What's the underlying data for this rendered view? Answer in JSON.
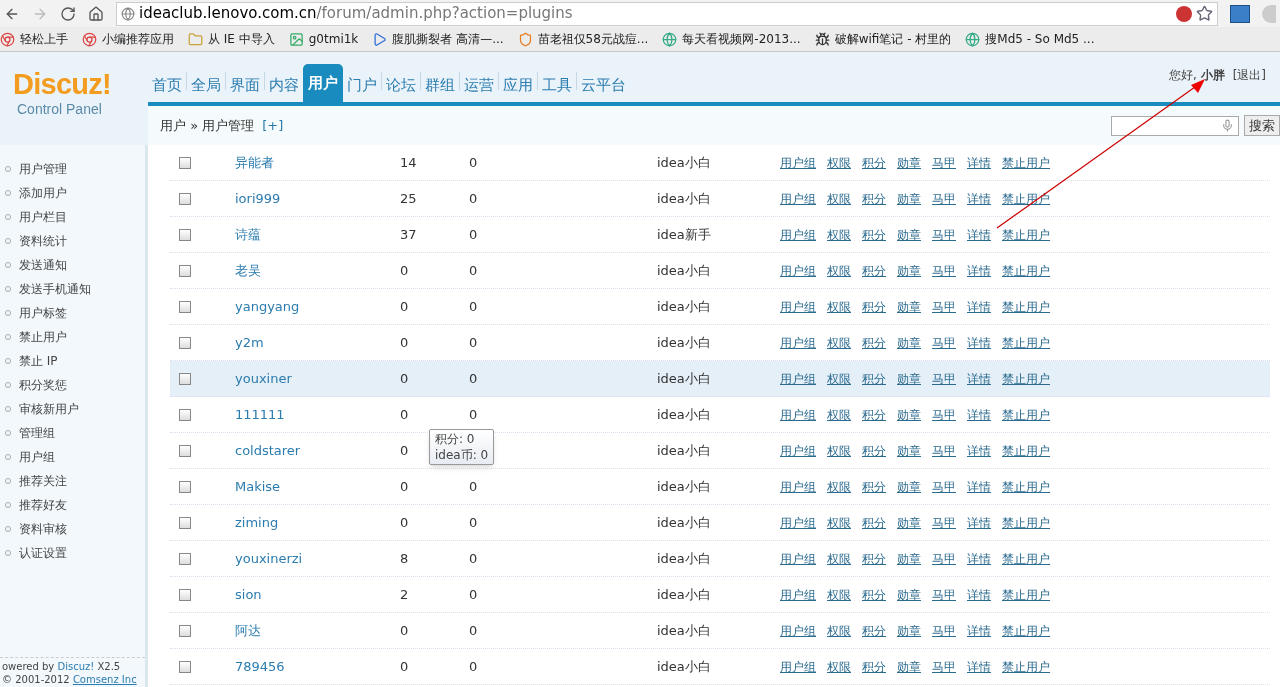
{
  "browser": {
    "url_host": "ideaclub.lenovo.com.cn",
    "url_path": "/forum/admin.php?action=plugins",
    "bookmarks": [
      {
        "label": "轻松上手",
        "kind": "chrome"
      },
      {
        "label": "小编推荐应用",
        "kind": "chrome"
      },
      {
        "label": "从 IE 中导入",
        "kind": "folder"
      },
      {
        "label": "g0tmi1k",
        "kind": "image"
      },
      {
        "label": "腹肌撕裂者 高清—...",
        "kind": "play"
      },
      {
        "label": "苗老祖仅58元战痘...",
        "kind": "shield"
      },
      {
        "label": "每天看视频网-2013...",
        "kind": "globe"
      },
      {
        "label": "破解wifi笔记 - 村里的",
        "kind": "bug"
      },
      {
        "label": "搜Md5 - So Md5 ...",
        "kind": "globe"
      }
    ]
  },
  "logo": {
    "title": "Discuz!",
    "subtitle": "Control Panel"
  },
  "nav_tabs": [
    {
      "label": "首页",
      "selected": false
    },
    {
      "label": "全局",
      "selected": false
    },
    {
      "label": "界面",
      "selected": false
    },
    {
      "label": "内容",
      "selected": false
    },
    {
      "label": "用户",
      "selected": true
    },
    {
      "label": "门户",
      "selected": false
    },
    {
      "label": "论坛",
      "selected": false
    },
    {
      "label": "群组",
      "selected": false
    },
    {
      "label": "运营",
      "selected": false
    },
    {
      "label": "应用",
      "selected": false
    },
    {
      "label": "工具",
      "selected": false
    },
    {
      "label": "云平台",
      "selected": false
    }
  ],
  "user_greeting": "您好, **小胖**",
  "logout": "[退出]",
  "breadcrumb": "用户 » 用户管理",
  "breadcrumb_add": "[+]",
  "search_button": "搜索",
  "sidebar": {
    "items": [
      "用户管理",
      "添加用户",
      "用户栏目",
      "资料统计",
      "发送通知",
      "发送手机通知",
      "用户标签",
      "禁止用户",
      "禁止 IP",
      "积分奖惩",
      "审核新用户",
      "管理组",
      "用户组",
      "推荐关注",
      "推荐好友",
      "资料审核",
      "认证设置"
    ],
    "footer_1": "owered by ",
    "footer_brand": "Discuz!",
    "footer_version": " X2.5",
    "footer_2": "© 2001-2012 ",
    "footer_company": "Comsenz Inc"
  },
  "table": {
    "rows": [
      {
        "username": "异能者",
        "column_3": "14",
        "column_4": "0",
        "group": "idea小白",
        "checked": false,
        "highlighted": false,
        "actions": [
          "用户组",
          "权限",
          "积分",
          "勋章",
          "马甲",
          "详情",
          "禁止用户"
        ]
      },
      {
        "username": "iori999",
        "column_3": "25",
        "column_4": "0",
        "group": "idea小白",
        "checked": false,
        "highlighted": false,
        "actions": [
          "用户组",
          "权限",
          "积分",
          "勋章",
          "马甲",
          "详情",
          "禁止用户"
        ]
      },
      {
        "username": "诗蕴",
        "column_3": "37",
        "column_4": "0",
        "group": "idea新手",
        "checked": false,
        "highlighted": false,
        "actions": [
          "用户组",
          "权限",
          "积分",
          "勋章",
          "马甲",
          "详情",
          "禁止用户"
        ]
      },
      {
        "username": "老吴",
        "column_3": "0",
        "column_4": "0",
        "group": "idea小白",
        "checked": false,
        "highlighted": false,
        "actions": [
          "用户组",
          "权限",
          "积分",
          "勋章",
          "马甲",
          "详情",
          "禁止用户"
        ]
      },
      {
        "username": "yangyang",
        "column_3": "0",
        "column_4": "0",
        "group": "idea小白",
        "checked": false,
        "highlighted": false,
        "actions": [
          "用户组",
          "权限",
          "积分",
          "勋章",
          "马甲",
          "详情",
          "禁止用户"
        ]
      },
      {
        "username": "y2m",
        "column_3": "0",
        "column_4": "0",
        "group": "idea小白",
        "checked": false,
        "highlighted": false,
        "actions": [
          "用户组",
          "权限",
          "积分",
          "勋章",
          "马甲",
          "详情",
          "禁止用户"
        ]
      },
      {
        "username": "youxiner",
        "column_3": "0",
        "column_4": "0",
        "group": "idea小白",
        "checked": false,
        "highlighted": true,
        "actions": [
          "用户组",
          "权限",
          "积分",
          "勋章",
          "马甲",
          "详情",
          "禁止用户"
        ]
      },
      {
        "username": "111111",
        "column_3": "0",
        "column_4": "0",
        "group": "idea小白",
        "checked": false,
        "highlighted": false,
        "actions": [
          "用户组",
          "权限",
          "积分",
          "勋章",
          "马甲",
          "详情",
          "禁止用户"
        ]
      },
      {
        "username": "coldstarer",
        "column_3": "0",
        "group": "idea小白",
        "checked": false,
        "highlighted": false,
        "tooltip": [
          "积分: 0",
          "idea币: 0"
        ],
        "actions": [
          "用户组",
          "权限",
          "积分",
          "勋章",
          "马甲",
          "详情",
          "禁止用户"
        ]
      },
      {
        "username": "Makise",
        "column_3": "0",
        "column_4": "0",
        "group": "idea小白",
        "checked": false,
        "highlighted": false,
        "actions": [
          "用户组",
          "权限",
          "积分",
          "勋章",
          "马甲",
          "详情",
          "禁止用户"
        ]
      },
      {
        "username": "ziming",
        "column_3": "0",
        "column_4": "0",
        "group": "idea小白",
        "checked": false,
        "highlighted": false,
        "actions": [
          "用户组",
          "权限",
          "积分",
          "勋章",
          "马甲",
          "详情",
          "禁止用户"
        ]
      },
      {
        "username": "youxinerzi",
        "column_3": "8",
        "column_4": "0",
        "group": "idea小白",
        "checked": false,
        "highlighted": false,
        "actions": [
          "用户组",
          "权限",
          "积分",
          "勋章",
          "马甲",
          "详情",
          "禁止用户"
        ]
      },
      {
        "username": "sion",
        "column_3": "2",
        "column_4": "0",
        "group": "idea小白",
        "checked": false,
        "highlighted": false,
        "actions": [
          "用户组",
          "权限",
          "积分",
          "勋章",
          "马甲",
          "详情",
          "禁止用户"
        ]
      },
      {
        "username": "阿达",
        "column_3": "0",
        "column_4": "0",
        "group": "idea小白",
        "checked": false,
        "highlighted": false,
        "actions": [
          "用户组",
          "权限",
          "积分",
          "勋章",
          "马甲",
          "详情",
          "禁止用户"
        ]
      },
      {
        "username": "789456",
        "column_3": "0",
        "column_4": "0",
        "group": "idea小白",
        "checked": false,
        "highlighted": false,
        "actions": [
          "用户组",
          "权限",
          "积分",
          "勋章",
          "马甲",
          "详情",
          "禁止用户"
        ]
      }
    ]
  }
}
